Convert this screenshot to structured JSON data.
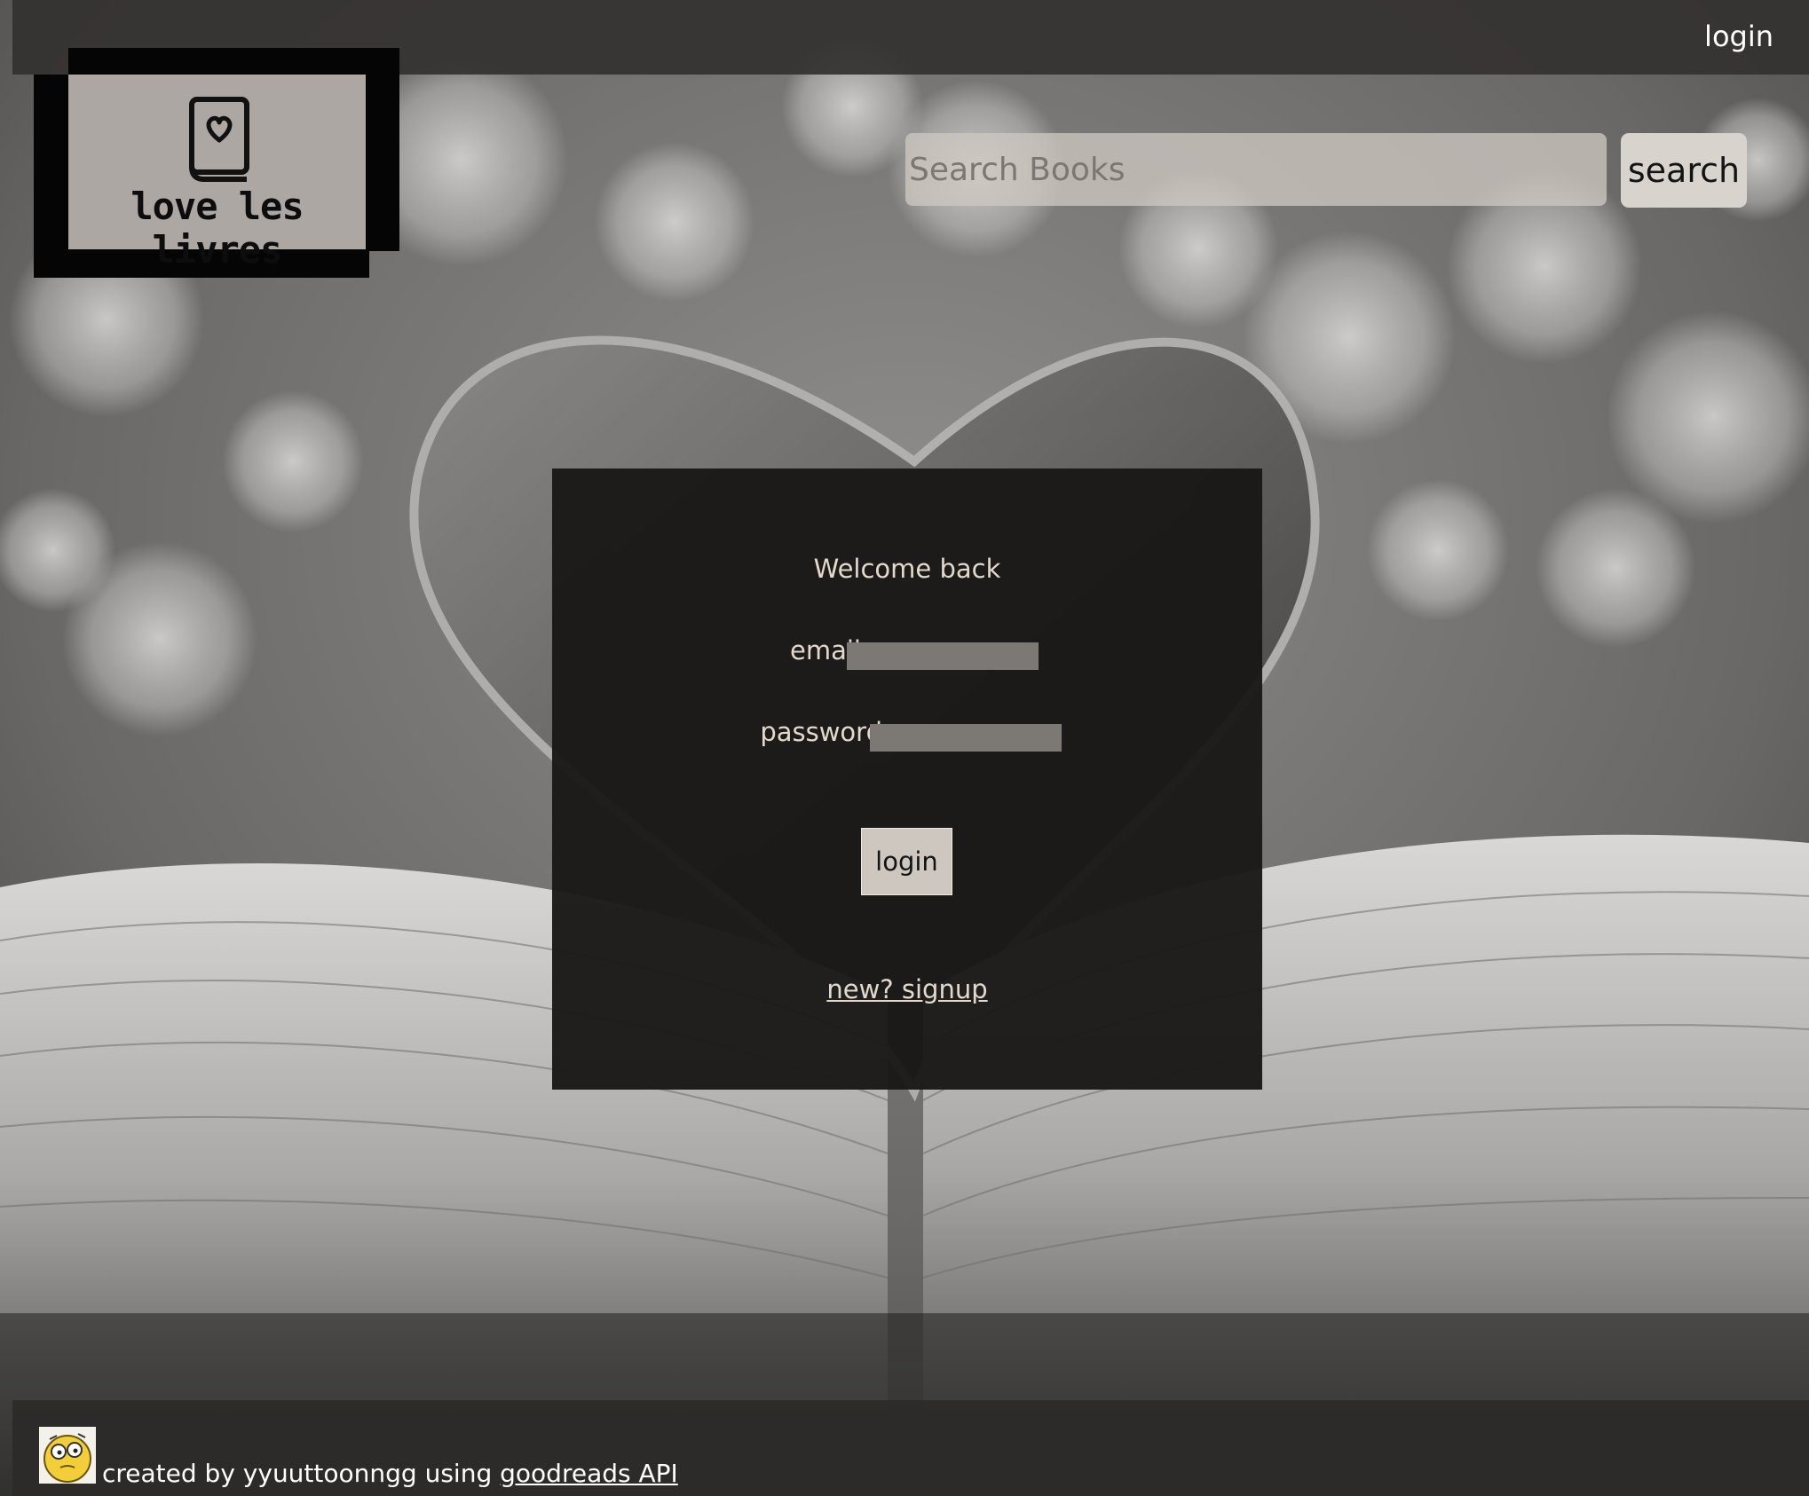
{
  "nav": {
    "login_label": "login"
  },
  "logo": {
    "text": "love les livres",
    "icon": "book-heart-icon"
  },
  "search": {
    "placeholder": "Search Books",
    "value": "",
    "button_label": "search"
  },
  "login_panel": {
    "welcome": "Welcome back",
    "email_label": "email",
    "email_value": "",
    "password_label": "password",
    "password_value": "",
    "submit_label": "login",
    "signup_link": "new? signup"
  },
  "footer": {
    "prefix": "created by yyuuttoonngg using",
    "link_label": "goodreads API",
    "avatar_icon": "cartoon-face-avatar"
  },
  "colors": {
    "panel_bg": "#191817",
    "panel_text": "#e2d9cc",
    "logo_bg": "#aca7a2",
    "button_bg": "#cdc7bf"
  }
}
